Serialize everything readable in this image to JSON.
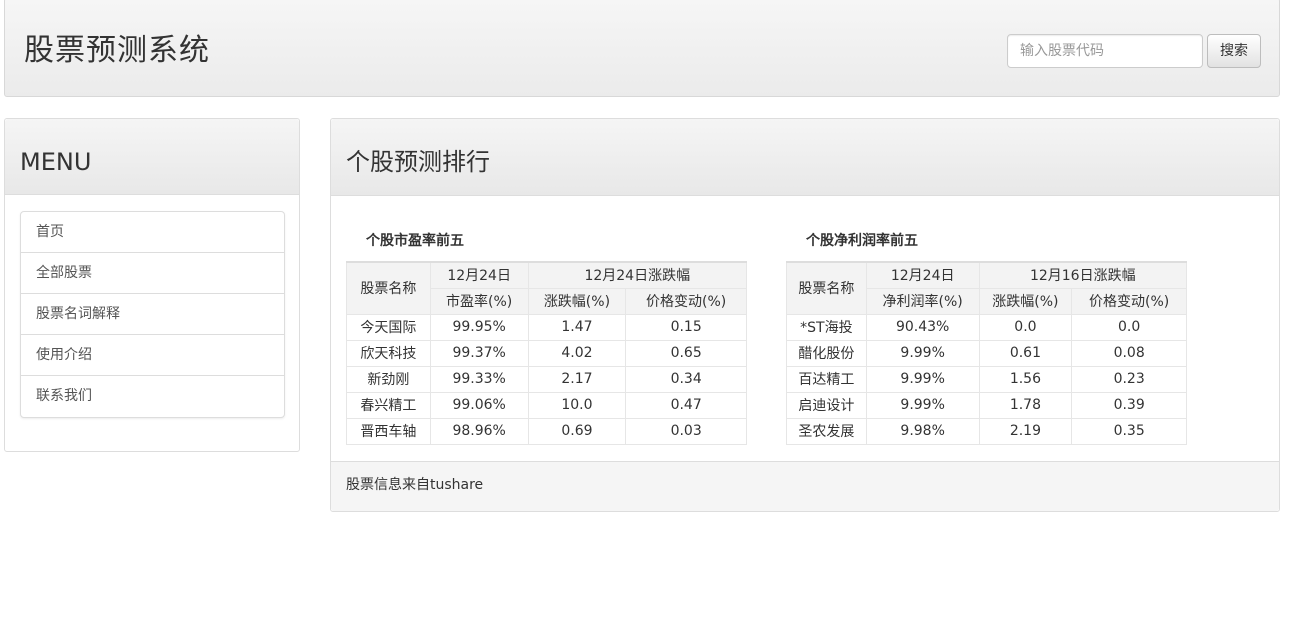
{
  "header": {
    "title": "股票预测系统",
    "search_placeholder": "输入股票代码",
    "search_button": "搜索"
  },
  "menu": {
    "title": "MENU",
    "items": [
      "首页",
      "全部股票",
      "股票名词解释",
      "使用介绍",
      "联系我们"
    ]
  },
  "main": {
    "title": "个股预测排行",
    "footer": "股票信息来自tushare",
    "colors": {
      "link": "#337ab7",
      "highlight": "#c9161a"
    },
    "pe_table": {
      "caption": "个股市盈率前五",
      "header": {
        "name": "股票名称",
        "metric_date": "12月24日",
        "metric": "市盈率(%)",
        "change_group": "12月24日涨跌幅",
        "change_pct": "涨跌幅(%)",
        "price_change": "价格变动(%)"
      },
      "rows": [
        {
          "name": "今天国际",
          "metric": "99.95%",
          "change_pct": "1.47",
          "price_change": "0.15"
        },
        {
          "name": "欣天科技",
          "metric": "99.37%",
          "change_pct": "4.02",
          "price_change": "0.65"
        },
        {
          "name": "新劲刚",
          "metric": "99.33%",
          "change_pct": "2.17",
          "price_change": "0.34"
        },
        {
          "name": "春兴精工",
          "metric": "99.06%",
          "change_pct": "10.0",
          "price_change": "0.47"
        },
        {
          "name": "晋西车轴",
          "metric": "98.96%",
          "change_pct": "0.69",
          "price_change": "0.03"
        }
      ]
    },
    "profit_table": {
      "caption": "个股净利润率前五",
      "header": {
        "name": "股票名称",
        "metric_date": "12月24日",
        "metric": "净利润率(%)",
        "change_group": "12月16日涨跌幅",
        "change_pct": "涨跌幅(%)",
        "price_change": "价格变动(%)"
      },
      "rows": [
        {
          "name": "*ST海投",
          "metric": "90.43%",
          "change_pct": "0.0",
          "price_change": "0.0"
        },
        {
          "name": "醋化股份",
          "metric": "9.99%",
          "change_pct": "0.61",
          "price_change": "0.08"
        },
        {
          "name": "百达精工",
          "metric": "9.99%",
          "change_pct": "1.56",
          "price_change": "0.23"
        },
        {
          "name": "启迪设计",
          "metric": "9.99%",
          "change_pct": "1.78",
          "price_change": "0.39"
        },
        {
          "name": "圣农发展",
          "metric": "9.98%",
          "change_pct": "2.19",
          "price_change": "0.35"
        }
      ]
    }
  }
}
